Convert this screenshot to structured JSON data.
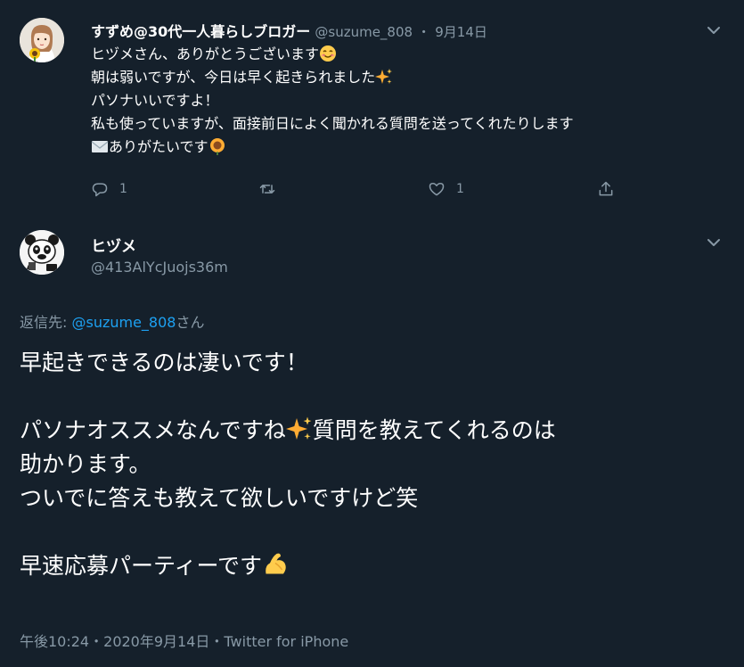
{
  "colors": {
    "background": "#15202b",
    "text_primary": "#ffffff",
    "text_secondary": "#8899a6",
    "link": "#1da1f2",
    "divider": "#38444d"
  },
  "reply_tweet": {
    "display_name": "すずめ@30代一人暮らしブロガー",
    "handle": "@suzume_808",
    "separator": "・",
    "date": "9月14日",
    "avatar_icon": "woman-with-sunflower-avatar",
    "menu_icon": "chevron-down-icon",
    "lines": [
      {
        "text": "ヒヅメさん、ありがとうございます",
        "emoji": "smiling-face-emoji"
      },
      {
        "text": "朝は弱いですが、今日は早く起きられました",
        "emoji": "sparkles-emoji"
      },
      {
        "text": "パソナいいですよ！",
        "emoji": ""
      },
      {
        "text": "私も使っていますが、面接前日によく聞かれる質問を送ってくれたりします",
        "emoji": ""
      },
      {
        "text": "ありがたいです",
        "emoji_before": "envelope-emoji",
        "emoji": "sunflower-emoji"
      }
    ],
    "actions": {
      "reply_count": "1",
      "retweet_count": "",
      "like_count": "1",
      "share_count": ""
    }
  },
  "main_tweet": {
    "display_name": "ヒヅメ",
    "handle": "@413AlYcJuojs36m",
    "avatar_icon": "panda-avatar",
    "menu_icon": "chevron-down-icon",
    "reply_prefix": "返信先: ",
    "reply_mention": "@suzume_808",
    "reply_suffix": "さん",
    "body": {
      "line1": "早起きできるのは凄いです！",
      "line2a": "パソナオススメなんですね",
      "line2b": "質問を教えてくれるのは",
      "line3": "助かります。",
      "line4": "ついでに答えも教えて欲しいですけど笑",
      "line5": "早速応募パーティーです"
    },
    "meta": {
      "time": "午後10:24",
      "separator": "・",
      "date": "2020年9月14日",
      "separator2": "・",
      "source": "Twitter for iPhone"
    }
  }
}
